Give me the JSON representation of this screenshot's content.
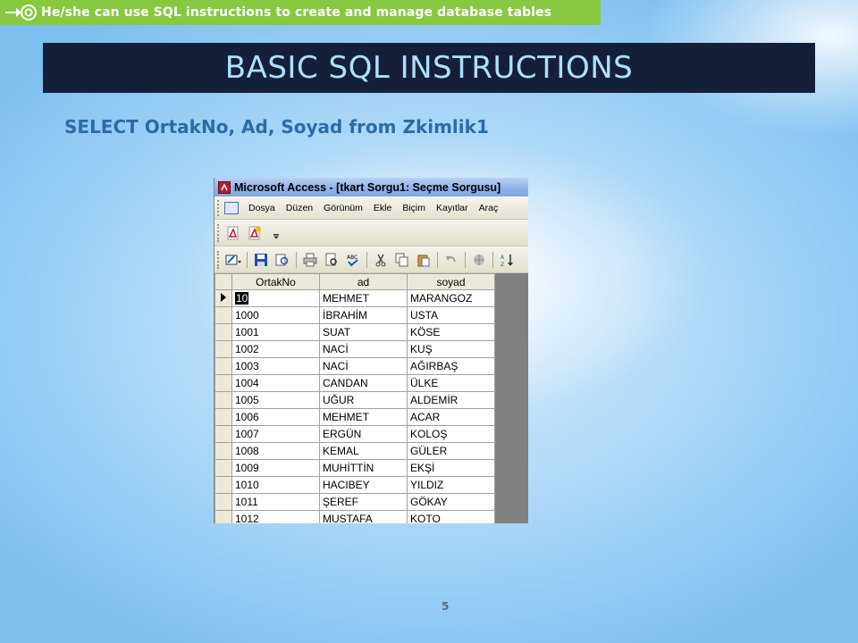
{
  "header": {
    "objective_text": "He/she can use SQL instructions to create and manage database tables",
    "bullet_icon": "arrow-target-icon"
  },
  "slide": {
    "title": "BASIC SQL INSTRUCTIONS",
    "sql_statement": "SELECT OrtakNo, Ad, Soyad from Zkimlik1",
    "page_number": "5"
  },
  "access_window": {
    "caption": "Microsoft Access - [tkart Sorgu1: Seçme Sorgusu]",
    "menu": [
      "Dosya",
      "Düzen",
      "Görünüm",
      "Ekle",
      "Biçim",
      "Kayıtlar",
      "Araç"
    ],
    "grid": {
      "columns": [
        "OrtakNo",
        "ad",
        "soyad"
      ],
      "rows": [
        [
          "10",
          "MEHMET",
          "MARANGOZ"
        ],
        [
          "1000",
          "İBRAHİM",
          "USTA"
        ],
        [
          "1001",
          "SUAT",
          "KÖSE"
        ],
        [
          "1002",
          "NACİ",
          "KUŞ"
        ],
        [
          "1003",
          "NACİ",
          "AĞIRBAŞ"
        ],
        [
          "1004",
          "CANDAN",
          "ÜLKE"
        ],
        [
          "1005",
          "UĞUR",
          "ALDEMİR"
        ],
        [
          "1006",
          "MEHMET",
          "ACAR"
        ],
        [
          "1007",
          "ERGÜN",
          "KOLOŞ"
        ],
        [
          "1008",
          "KEMAL",
          "GÜLER"
        ],
        [
          "1009",
          "MUHİTTİN",
          "EKŞİ"
        ],
        [
          "1010",
          "HACIBEY",
          "YILDIZ"
        ],
        [
          "1011",
          "ŞEREF",
          "GÖKAY"
        ],
        [
          "1012",
          "MUSTAFA",
          "KOTO"
        ]
      ]
    }
  }
}
